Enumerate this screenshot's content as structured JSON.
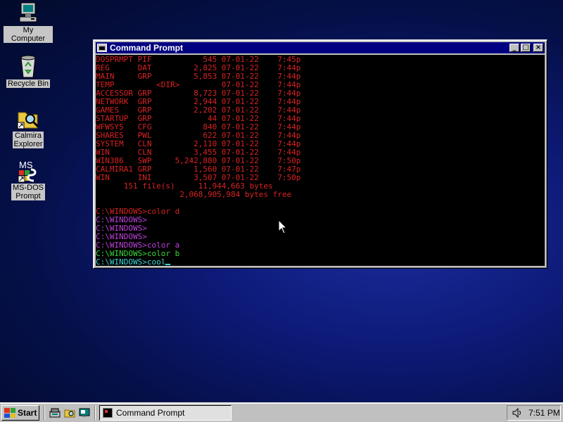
{
  "desktop": {
    "icons": [
      {
        "label": "My Computer",
        "icon": "my-computer-icon"
      },
      {
        "label": "Recycle Bin",
        "icon": "recycle-bin-icon"
      },
      {
        "label_line1": "Calmira",
        "label_line2": "Explorer",
        "icon": "calmira-explorer-icon"
      },
      {
        "label_line1": "MS-DOS",
        "label_line2": "Prompt",
        "icon": "ms-dos-prompt-icon",
        "badge": "MS"
      }
    ]
  },
  "window": {
    "title": "Command Prompt",
    "buttons": {
      "minimize": "_",
      "maximize": "□",
      "close": "×"
    },
    "listing": [
      "DOSPRMPT PIF           545 07-01-22    7:45p",
      "REG      DAT         2,825 07-01-22    7:44p",
      "MAIN     GRP         5,853 07-01-22    7:44p",
      "TEMP         <DIR>         07-01-22    7:44p",
      "ACCESSOR GRP         8,723 07-01-22    7:44p",
      "NETWORK  GRP         2,944 07-01-22    7:44p",
      "GAMES    GRP         2,202 07-01-22    7:44p",
      "STARTUP  GRP            44 07-01-22    7:44p",
      "WFWSYS   CFG           840 07-01-22    7:44p",
      "SHARES   PWL           622 07-01-22    7:44p",
      "SYSTEM   CLN         2,110 07-01-22    7:44p",
      "WIN      CLN         3,455 07-01-22    7:44p",
      "WIN386   SWP     5,242,880 07-01-22    7:50p",
      "CALMIRA1 GRP         1,560 07-01-22    7:47p",
      "WIN      INI         3,507 07-01-22    7:50p",
      "      151 file(s)     11,944,663 bytes",
      "                  2,068,905,984 bytes free"
    ],
    "blank": "",
    "prompts": [
      {
        "text": "C:\\WINDOWS>color d",
        "color": "red"
      },
      {
        "text": "C:\\WINDOWS>",
        "color": "magenta"
      },
      {
        "text": "C:\\WINDOWS>",
        "color": "magenta"
      },
      {
        "text": "C:\\WINDOWS>",
        "color": "magenta"
      },
      {
        "text": "C:\\WINDOWS>color a",
        "color": "magenta"
      },
      {
        "text": "C:\\WINDOWS>color b",
        "color": "green"
      },
      {
        "text": "C:\\WINDOWS>cool",
        "color": "cyan"
      }
    ]
  },
  "taskbar": {
    "start_label": "Start",
    "task_label": "Command Prompt",
    "clock": "7:51 PM"
  },
  "colors": {
    "console_red": "#d92323",
    "console_magenta": "#c040e0",
    "console_green": "#3ad93a",
    "console_cyan": "#3ad6d6",
    "titlebar": "#000080"
  }
}
